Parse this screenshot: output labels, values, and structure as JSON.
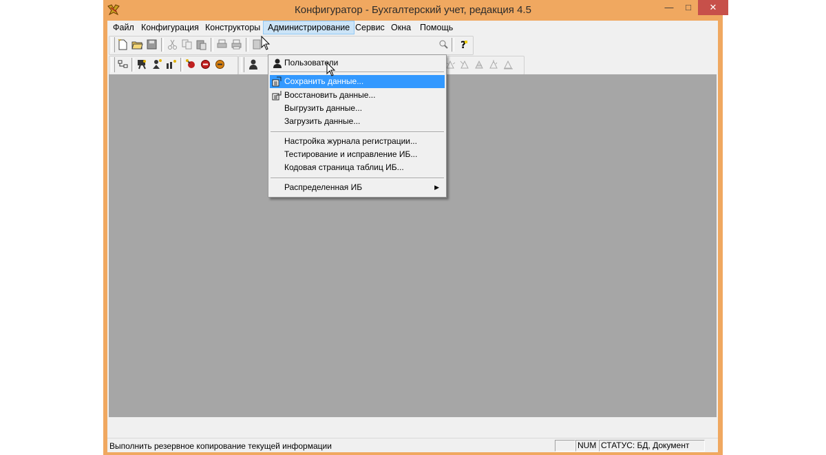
{
  "window": {
    "title": "Конфигуратор - Бухгалтерский учет, редакция 4.5",
    "minimize": "—",
    "maximize": "□",
    "close": "✕"
  },
  "menubar": {
    "items": [
      "Файл",
      "Конфигурация",
      "Конструкторы",
      "Администрирование",
      "Сервис",
      "Окна",
      "Помощь"
    ],
    "active_index": 3
  },
  "admin_menu": {
    "items": [
      {
        "label": "Пользователи",
        "icon": "users-icon"
      },
      {
        "label": "Сохранить данные...",
        "icon": "save-data-icon",
        "highlighted": true
      },
      {
        "label": "Восстановить данные...",
        "icon": "restore-data-icon"
      },
      {
        "label": "Выгрузить данные...",
        "icon": ""
      },
      {
        "label": "Загрузить данные...",
        "icon": ""
      },
      {
        "label": "Настройка журнала регистрации...",
        "icon": ""
      },
      {
        "label": "Тестирование и исправление ИБ...",
        "icon": ""
      },
      {
        "label": "Кодовая страница таблиц ИБ...",
        "icon": ""
      },
      {
        "label": "Распределенная ИБ",
        "icon": "",
        "submenu": true
      }
    ],
    "submenu_arrow": "▶"
  },
  "statusbar": {
    "message": "Выполнить резервное копирование текущей информации",
    "num": "NUM",
    "status": "СТАТУС: БД, Документ"
  },
  "colors": {
    "window_frame": "#f0a860",
    "close_button": "#c7504a",
    "menu_highlight": "#3399ff",
    "mdi_background": "#a6a6a6"
  }
}
